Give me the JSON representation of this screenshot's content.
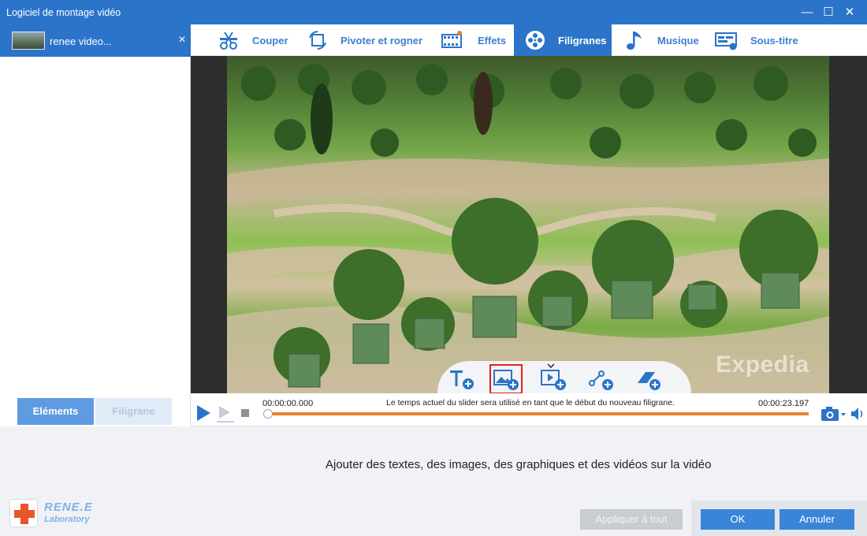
{
  "window": {
    "title": "Logiciel de montage vidéo",
    "controls": {
      "minimize": "—",
      "maximize": "☐",
      "close": "✕"
    }
  },
  "file_list": {
    "items": [
      {
        "label": "renee video...",
        "close": "×"
      }
    ]
  },
  "left_tabs": [
    {
      "label": "Eléments",
      "active": true
    },
    {
      "label": "Filigrane",
      "active": false
    }
  ],
  "top_tabs": [
    {
      "label": "Couper",
      "icon": "scissors-icon",
      "active": false
    },
    {
      "label": "Pivoter et rogner",
      "icon": "crop-rotate-icon",
      "active": false
    },
    {
      "label": "Effets",
      "icon": "film-effects-icon",
      "active": false
    },
    {
      "label": "Filigranes",
      "icon": "film-reel-icon",
      "active": true
    },
    {
      "label": "Musique",
      "icon": "music-note-icon",
      "active": false
    },
    {
      "label": "Sous-titre",
      "icon": "subtitle-icon",
      "active": false
    }
  ],
  "preview": {
    "watermark_text": "Expedia"
  },
  "float_tools": [
    {
      "icon": "add-text-icon"
    },
    {
      "icon": "add-image-icon",
      "selected": true
    },
    {
      "icon": "add-video-icon"
    },
    {
      "icon": "add-shape-icon"
    },
    {
      "icon": "add-eraser-icon"
    }
  ],
  "playbar": {
    "current_time": "00:00:00.000",
    "hint": "Le temps actuel du slider sera utilisé en tant que le début du nouveau filigrane.",
    "total_time": "00:00:23.197",
    "progress": 0
  },
  "bottom": {
    "description": "Ajouter des textes, des images, des graphiques et des vidéos sur la vidéo",
    "logo_line1": "RENE.E",
    "logo_line2": "Laboratory",
    "apply_all": "Appliquer à tout",
    "ok": "OK",
    "cancel": "Annuler"
  },
  "colors": {
    "accent": "#2b74c9",
    "slider": "#e8832a",
    "selection_outline": "#e02020"
  }
}
